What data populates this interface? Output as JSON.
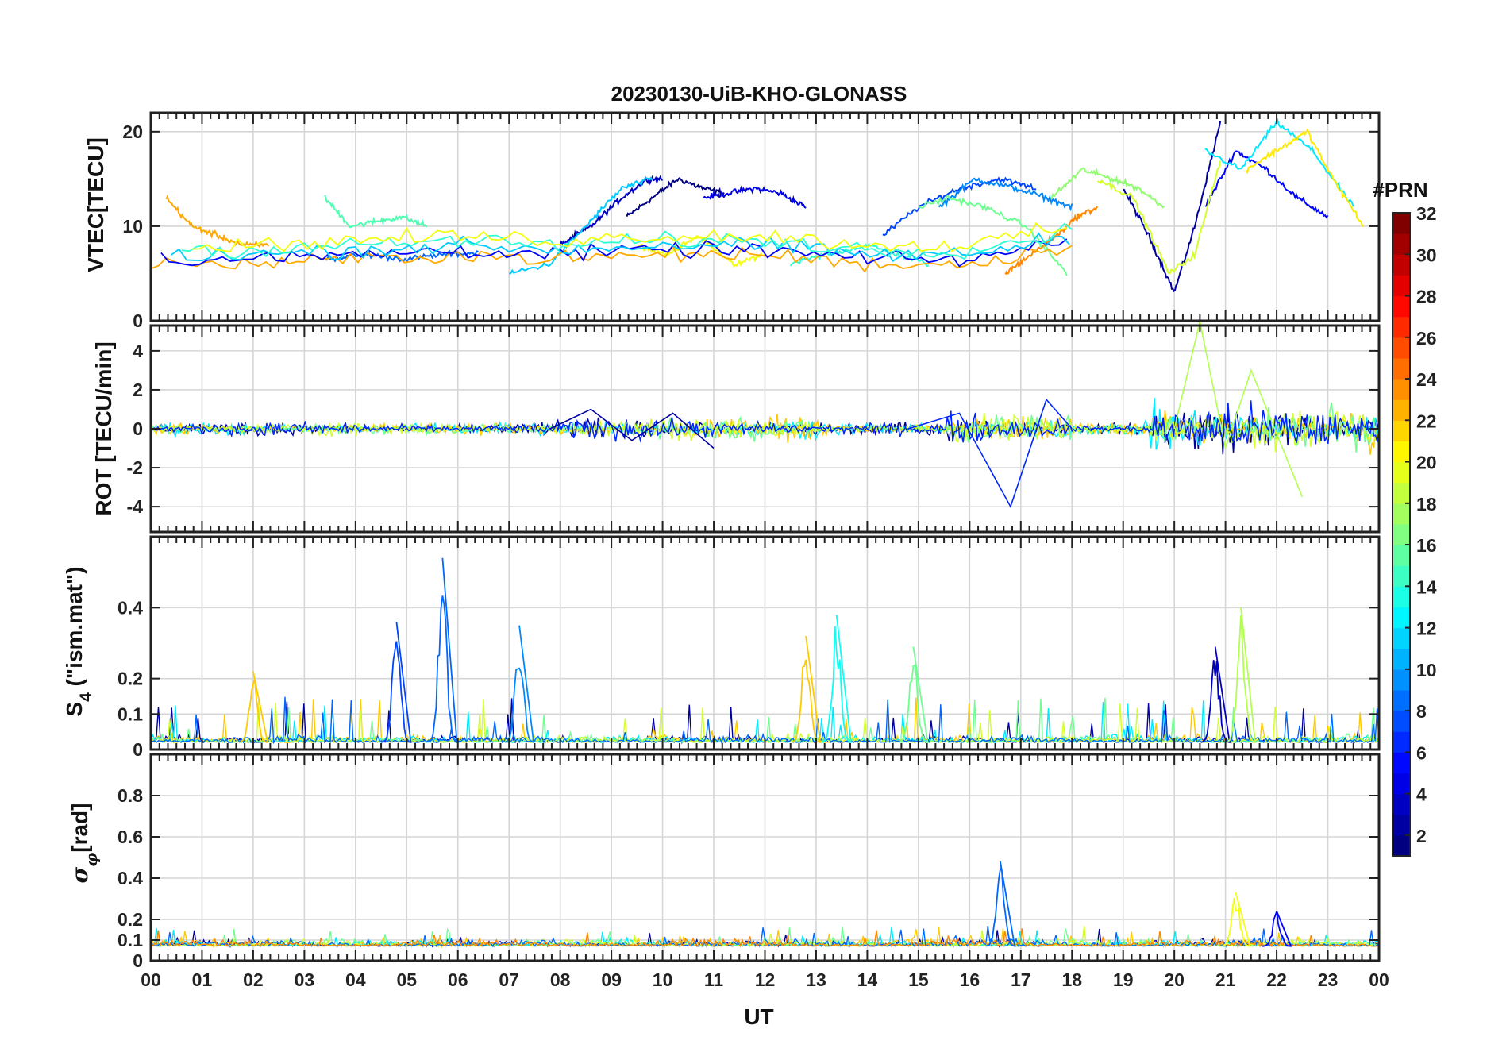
{
  "chart_data": {
    "type": "line",
    "title": "20230130-UiB-KHO-GLONASS",
    "xlabel": "UT",
    "x_tick_labels": [
      "00",
      "01",
      "02",
      "03",
      "04",
      "05",
      "06",
      "07",
      "08",
      "09",
      "10",
      "11",
      "12",
      "13",
      "14",
      "15",
      "16",
      "17",
      "18",
      "19",
      "20",
      "21",
      "22",
      "23",
      "00"
    ],
    "xlim_hours": [
      0,
      24
    ],
    "grid": true,
    "panels": [
      {
        "id": "vtec",
        "ylabel": "VTEC[TECU]",
        "ylim": [
          0,
          22
        ],
        "yticks": [
          0,
          10,
          20
        ],
        "ytick_labels": [
          "0",
          "10",
          "20"
        ],
        "series": [
          {
            "prn": 1,
            "x": [
              9.3,
              9.8,
              10.3,
              10.8,
              11.2
            ],
            "y": [
              11,
              13,
              15,
              14,
              13.5
            ]
          },
          {
            "prn": 2,
            "x": [
              19.0,
              19.5,
              20.0,
              20.4,
              20.9
            ],
            "y": [
              14,
              9,
              3,
              10,
              21
            ]
          },
          {
            "prn": 3,
            "x": [
              8.0,
              8.6,
              9.2,
              9.7,
              10.0
            ],
            "y": [
              8,
              10,
              13,
              15,
              15
            ]
          },
          {
            "prn": 4,
            "x": [
              10.8,
              11.3,
              11.8,
              12.3,
              12.8
            ],
            "y": [
              13,
              13.5,
              14,
              13.5,
              12
            ]
          },
          {
            "prn": 5,
            "x": [
              20.6,
              21.2,
              21.8,
              22.4,
              23.0
            ],
            "y": [
              12,
              18,
              16,
              13,
              11
            ]
          },
          {
            "prn": 7,
            "x": [
              14.3,
              15.0,
              15.8,
              16.6,
              17.3
            ],
            "y": [
              9,
              12,
              14,
              15,
              14
            ]
          },
          {
            "prn": 8,
            "x": [
              3.4,
              4.2,
              5.0,
              5.7,
              6.4
            ],
            "y": [
              6.5,
              7,
              6.5,
              7,
              7.2
            ]
          },
          {
            "prn": 9,
            "x": [
              15.4,
              16.1,
              16.9,
              17.5,
              18.0
            ],
            "y": [
              12,
              15,
              14,
              13,
              12
            ]
          },
          {
            "prn": 11,
            "x": [
              7.0,
              7.8,
              8.5,
              9.2,
              9.8
            ],
            "y": [
              5,
              6,
              10,
              14,
              15
            ]
          },
          {
            "prn": 12,
            "x": [
              20.6,
              21.3,
              22.0,
              22.7,
              23.5
            ],
            "y": [
              18,
              16,
              21,
              18,
              12
            ]
          },
          {
            "prn": 14,
            "x": [
              12.5,
              13.2,
              14.0,
              14.6,
              15.2
            ],
            "y": [
              6,
              7,
              8,
              7,
              6
            ]
          },
          {
            "prn": 15,
            "x": [
              3.4,
              3.9,
              4.4,
              4.9,
              5.4
            ],
            "y": [
              13,
              10,
              10.5,
              11,
              10
            ]
          },
          {
            "prn": 16,
            "x": [
              15.0,
              15.6,
              16.3,
              17.1,
              17.9
            ],
            "y": [
              12,
              13,
              12,
              10,
              5
            ]
          },
          {
            "prn": 17,
            "x": [
              17.6,
              18.2,
              18.8,
              19.3,
              19.8
            ],
            "y": [
              13,
              16,
              15,
              14,
              12
            ]
          },
          {
            "prn": 19,
            "x": [
              18.5,
              19.2,
              19.9,
              20.4,
              20.9
            ],
            "y": [
              15,
              13,
              5,
              7,
              17
            ]
          },
          {
            "prn": 20,
            "x": [
              9.5,
              10.1,
              10.7,
              11.4,
              12.0
            ],
            "y": [
              8,
              7,
              9,
              6,
              7
            ]
          },
          {
            "prn": 21,
            "x": [
              21.4,
              22.0,
              22.6,
              23.1,
              23.7
            ],
            "y": [
              16,
              18,
              20,
              15,
              10
            ]
          },
          {
            "prn": 23,
            "x": [
              0.3,
              0.8,
              1.3,
              1.8,
              2.3
            ],
            "y": [
              13,
              10,
              9,
              8,
              8
            ]
          },
          {
            "prn": 24,
            "x": [
              16.7,
              17.2,
              17.7,
              18.1,
              18.5
            ],
            "y": [
              5,
              7,
              9,
              11,
              12
            ]
          }
        ]
      },
      {
        "id": "rot",
        "ylabel": "ROT [TECU/min]",
        "ylim": [
          -5.3,
          5.3
        ],
        "yticks": [
          -4,
          -2,
          0,
          2,
          4
        ],
        "ytick_labels": [
          "-4",
          "-2",
          "0",
          "2",
          "4"
        ],
        "series": [
          {
            "prn": 2,
            "x": [
              7.8,
              8.6,
              9.4,
              10.2,
              11.0
            ],
            "y": [
              0,
              1,
              -0.6,
              0.8,
              -1
            ]
          },
          {
            "prn": 6,
            "x": [
              14.8,
              15.8,
              16.8,
              17.5,
              18.0
            ],
            "y": [
              0,
              0.8,
              -4,
              1.5,
              0
            ]
          },
          {
            "prn": 18,
            "x": [
              20.0,
              20.5,
              21.0,
              21.5,
              22.5
            ],
            "y": [
              0,
              5.5,
              -1,
              3,
              -3.5
            ]
          }
        ]
      },
      {
        "id": "s4",
        "ylabel": "S4 (\"ism.mat\")",
        "ylim": [
          0,
          0.6
        ],
        "yticks": [
          0,
          0.1,
          0.2,
          0.4
        ],
        "ytick_labels": [
          "0",
          "0.1",
          "0.2",
          "0.4"
        ],
        "peaks": [
          {
            "prn": 22,
            "t": 2.0,
            "v": 0.22
          },
          {
            "prn": 7,
            "t": 4.8,
            "v": 0.36
          },
          {
            "prn": 8,
            "t": 5.7,
            "v": 0.54
          },
          {
            "prn": 9,
            "t": 7.2,
            "v": 0.35
          },
          {
            "prn": 22,
            "t": 12.8,
            "v": 0.32
          },
          {
            "prn": 13,
            "t": 13.4,
            "v": 0.38
          },
          {
            "prn": 16,
            "t": 14.9,
            "v": 0.29
          },
          {
            "prn": 3,
            "t": 20.8,
            "v": 0.29
          },
          {
            "prn": 18,
            "t": 21.3,
            "v": 0.4
          }
        ]
      },
      {
        "id": "sigma",
        "ylabel": "σφ[rad]",
        "ylim": [
          0,
          1.0
        ],
        "yticks": [
          0,
          0.1,
          0.2,
          0.4,
          0.6,
          0.8
        ],
        "ytick_labels": [
          "0",
          "0.1",
          "0.2",
          "0.4",
          "0.6",
          "0.8"
        ],
        "peaks": [
          {
            "prn": 8,
            "t": 16.6,
            "v": 0.48
          },
          {
            "prn": 20,
            "t": 21.2,
            "v": 0.33
          },
          {
            "prn": 5,
            "t": 22.0,
            "v": 0.24
          }
        ]
      }
    ],
    "colorbar": {
      "label": "#PRN",
      "range": [
        1,
        32
      ],
      "ticks": [
        2,
        4,
        6,
        8,
        10,
        12,
        14,
        16,
        18,
        20,
        22,
        24,
        26,
        28,
        30,
        32
      ],
      "tick_labels": [
        "2",
        "4",
        "6",
        "8",
        "10",
        "12",
        "14",
        "16",
        "18",
        "20",
        "22",
        "24",
        "26",
        "28",
        "30",
        "32"
      ],
      "colormap": "jet"
    }
  }
}
